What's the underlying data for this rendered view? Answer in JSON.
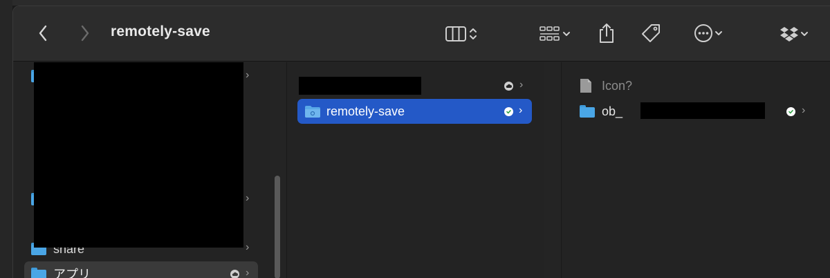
{
  "window": {
    "title": "remotely-save"
  },
  "toolbar": {
    "back_icon": "chevron-left-icon",
    "forward_icon": "chevron-right-icon",
    "view_icon": "columns-view-icon",
    "group_icon": "grid-group-icon",
    "share_icon": "share-icon",
    "tag_icon": "tag-icon",
    "more_icon": "ellipsis-circle-icon",
    "dropbox_icon": "dropbox-icon"
  },
  "column1": {
    "items": [
      {
        "label": ""
      },
      {
        "label": ""
      },
      {
        "label": "share"
      },
      {
        "label": "アプリ"
      }
    ]
  },
  "column2": {
    "items": [
      {
        "label": ""
      },
      {
        "label": "remotely-save"
      }
    ]
  },
  "column3": {
    "items": [
      {
        "label": "Icon?"
      },
      {
        "label": "ob_"
      }
    ]
  },
  "colors": {
    "selection": "#2459c7",
    "folder": "#4aa6e6",
    "sync_ok": "#2ea043"
  }
}
